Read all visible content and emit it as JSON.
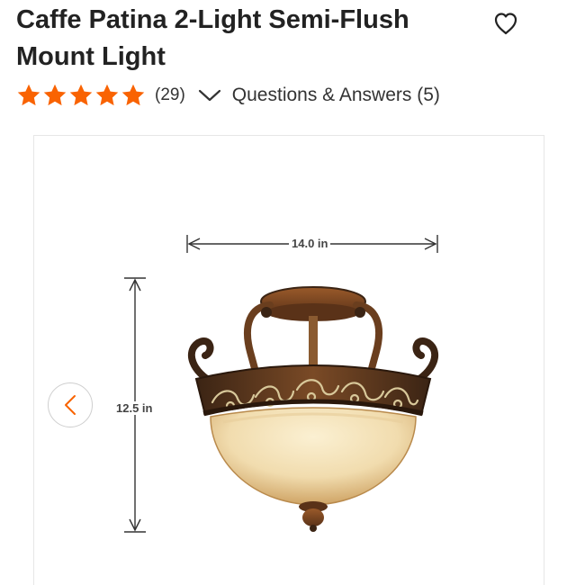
{
  "product": {
    "title": "Caffe Patina 2-Light Semi-Flush Mount Light",
    "rating": 5,
    "review_count": "(29)",
    "qa_link": "Questions & Answers (5)"
  },
  "image": {
    "width_dimension": "14.0 in",
    "height_dimension": "12.5 in"
  },
  "icons": {
    "favorite": "heart-outline-icon",
    "expand": "chevron-down-icon",
    "previous": "chevron-left-icon",
    "star": "star-icon"
  },
  "colors": {
    "star": "#f96302",
    "accent": "#f96302",
    "text": "#222222"
  }
}
